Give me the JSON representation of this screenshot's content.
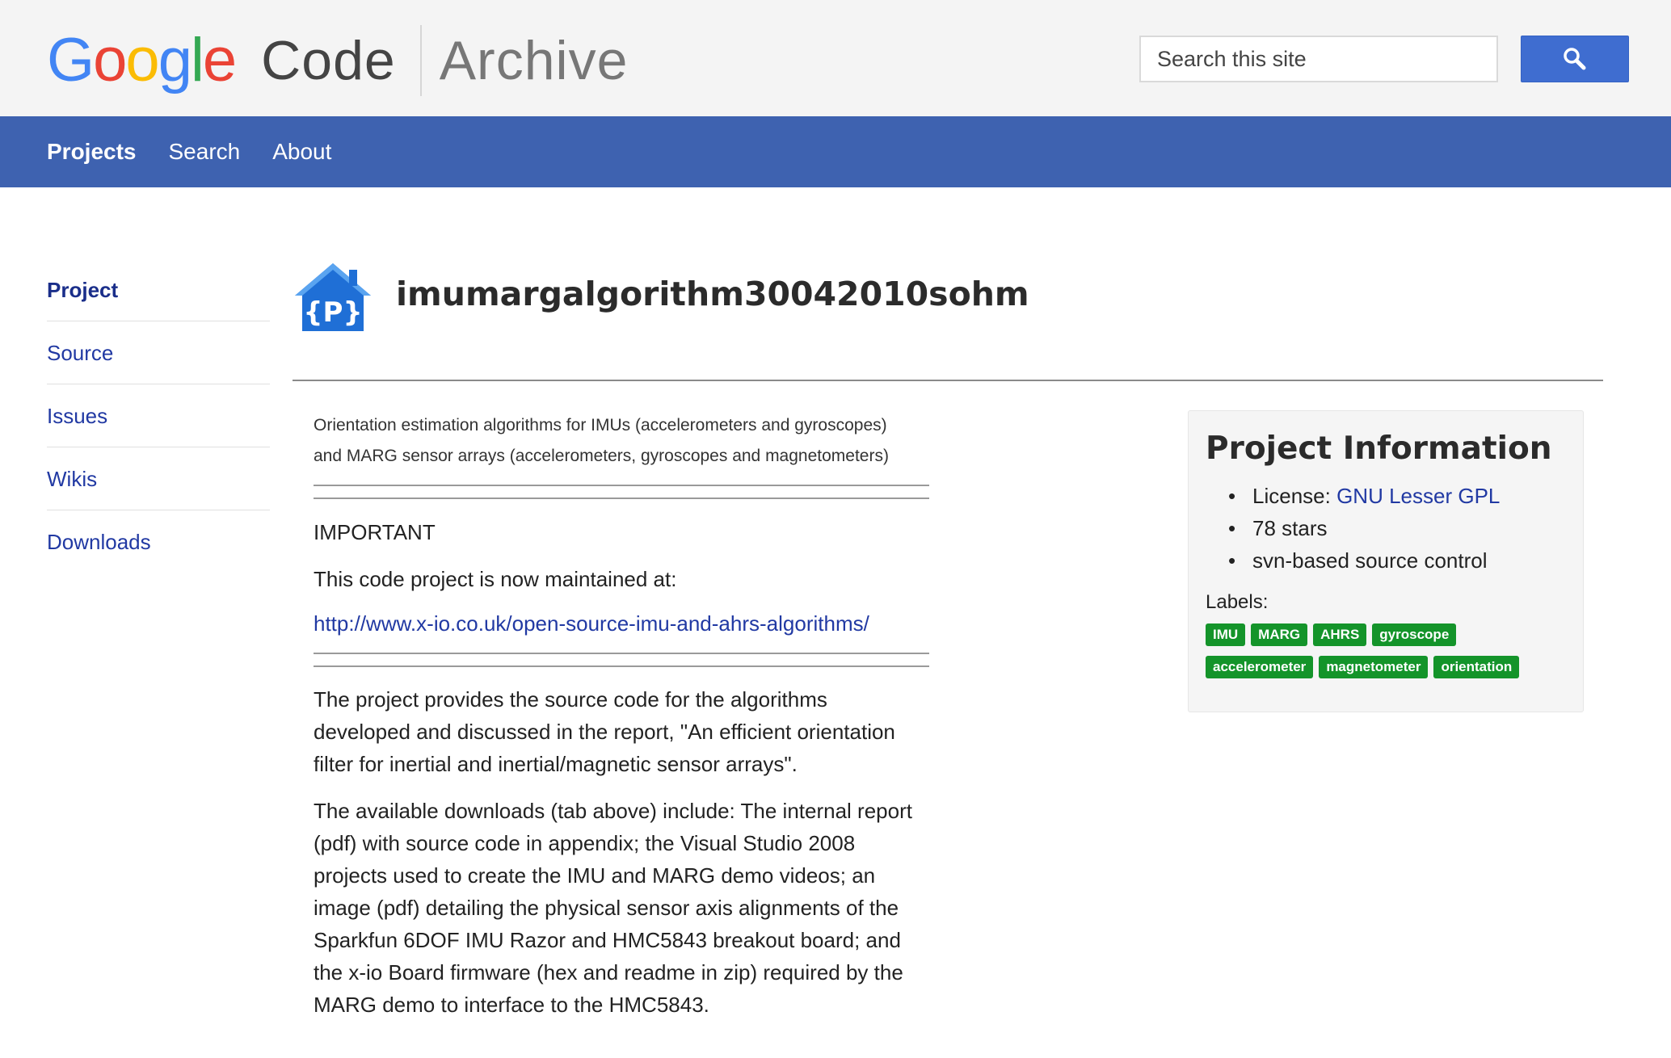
{
  "header": {
    "logo_letters": [
      {
        "char": "G",
        "color": "#4285f4"
      },
      {
        "char": "o",
        "color": "#ea4335"
      },
      {
        "char": "o",
        "color": "#fbbc05"
      },
      {
        "char": "g",
        "color": "#4285f4"
      },
      {
        "char": "l",
        "color": "#34a853"
      },
      {
        "char": "e",
        "color": "#ea4335"
      }
    ],
    "logo_code": "Code",
    "logo_archive": "Archive",
    "search_placeholder": "Search this site",
    "search_icon": "magnifier-icon"
  },
  "nav": {
    "items": [
      {
        "label": "Projects",
        "active": true
      },
      {
        "label": "Search",
        "active": false
      },
      {
        "label": "About",
        "active": false
      }
    ]
  },
  "sidebar": {
    "items": [
      {
        "label": "Project",
        "active": true
      },
      {
        "label": "Source",
        "active": false
      },
      {
        "label": "Issues",
        "active": false
      },
      {
        "label": "Wikis",
        "active": false
      },
      {
        "label": "Downloads",
        "active": false
      }
    ]
  },
  "project": {
    "icon": "project-house-icon",
    "icon_text": "{P}",
    "name": "imumargalgorithm30042010sohm",
    "summary_line1": "Orientation estimation algorithms for IMUs (accelerometers and gyroscopes)",
    "summary_line2": "and MARG sensor arrays (accelerometers, gyroscopes and magnetometers)",
    "important": "IMPORTANT",
    "maintained_text": "This code project is now maintained at:",
    "maintained_link": "http://www.x-io.co.uk/open-source-imu-and-ahrs-algorithms/",
    "description_lines": [
      "The project provides the source code for the algorithms",
      "developed and discussed in the report, \"An efficient orientation",
      "filter for inertial and inertial/magnetic sensor arrays\"."
    ],
    "downloads_lines": [
      "The available downloads (tab above) include: The internal report",
      "(pdf) with source code in appendix; the Visual Studio 2008",
      "projects used to create the IMU and MARG demo videos; an",
      "image (pdf) detailing the physical sensor axis alignments of the",
      "Sparkfun 6DOF IMU Razor and HMC5843 breakout board; and",
      "the x-io Board firmware (hex and readme in zip) required by the",
      "MARG demo to interface to the HMC5843."
    ]
  },
  "info": {
    "title": "Project Information",
    "license_prefix": "License: ",
    "license_link": "GNU Lesser GPL",
    "stars": "78 stars",
    "source_control": "svn-based source control",
    "labels_heading": "Labels:",
    "labels": [
      "IMU",
      "MARG",
      "AHRS",
      "gyroscope",
      "accelerometer",
      "magnetometer",
      "orientation"
    ],
    "label_color": "#14942a"
  },
  "colors": {
    "nav_bg": "#3e62b0",
    "link": "#2139a3",
    "search_button": "#3f6dd0"
  }
}
